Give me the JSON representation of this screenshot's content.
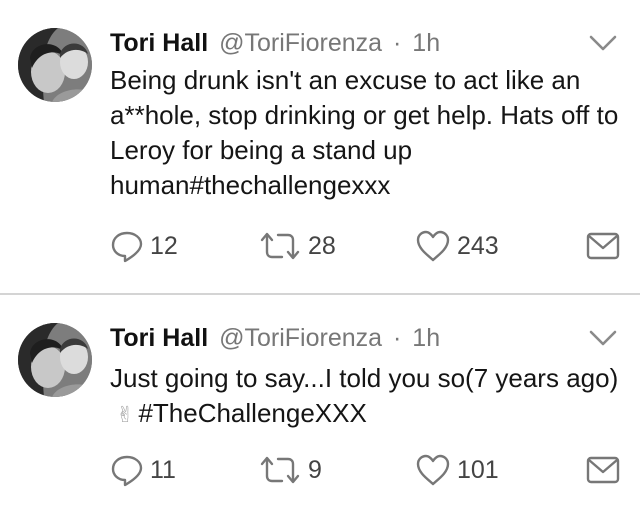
{
  "tweets": [
    {
      "name": "Tori Hall",
      "handle": "@ToriFiorenza",
      "separator": "·",
      "time": "1h",
      "text": "Being drunk isn't an excuse to act like an a**hole, stop drinking or get help. Hats off to Leroy for being a stand up human#thechallengexxx",
      "text_suffix": "",
      "replies": "12",
      "retweets": "28",
      "likes": "243"
    },
    {
      "name": "Tori Hall",
      "handle": "@ToriFiorenza",
      "separator": "·",
      "time": "1h",
      "text": "Just going to say...I told you so(7 years ago)",
      "emoji": "✌",
      "text_suffix": "#TheChallengeXXX",
      "replies": "11",
      "retweets": "9",
      "likes": "101"
    }
  ],
  "icons": {
    "reply": "reply-icon",
    "retweet": "retweet-icon",
    "like": "heart-icon",
    "dm": "envelope-icon",
    "more": "chevron-down-icon"
  },
  "colors": {
    "text": "#151515",
    "muted": "#777777",
    "divider": "#d4d4d4"
  }
}
